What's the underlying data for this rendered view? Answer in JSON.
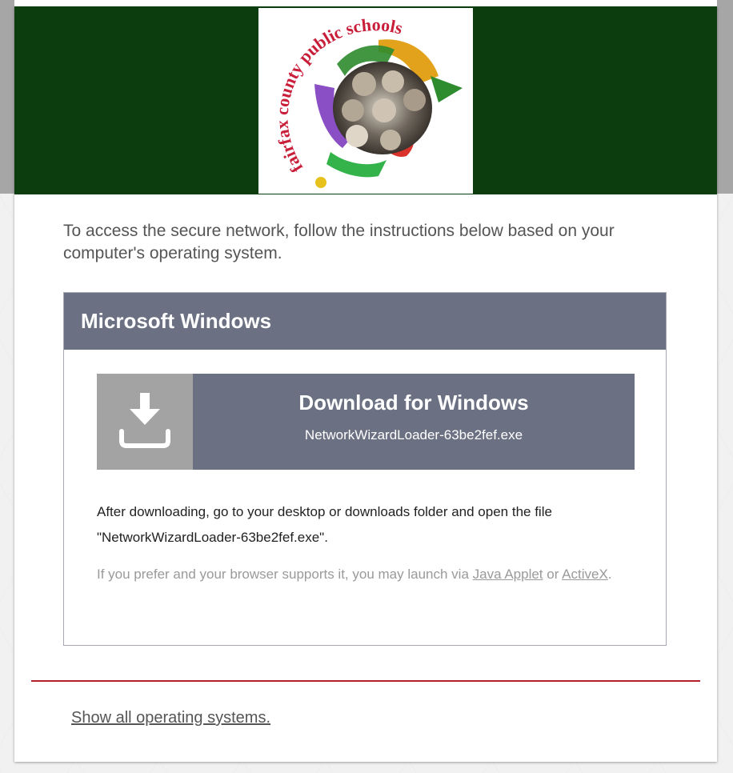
{
  "header": {
    "logo_text": "fairfax county public schools",
    "brand_color": "#0b3d0f"
  },
  "intro": {
    "text": "To access the secure network, follow the instructions below based on your computer's operating system."
  },
  "os_panel": {
    "title": "Microsoft Windows",
    "download_button": {
      "title": "Download for Windows",
      "filename": "NetworkWizardLoader-63be2fef.exe",
      "icon": "download-icon"
    },
    "after_text": "After downloading, go to your desktop or downloads folder and open the file \"NetworkWizardLoader-63be2fef.exe\".",
    "alt_text_prefix": "If you prefer and your browser supports it, you may launch via ",
    "java_link": "Java Applet",
    "alt_text_or": " or ",
    "activex_link": "ActiveX",
    "alt_text_suffix": "."
  },
  "footer": {
    "show_all_link": "Show all operating systems."
  },
  "colors": {
    "panel_header": "#6b7182",
    "icon_box": "#a3a3a3",
    "divider": "#b3202a"
  }
}
